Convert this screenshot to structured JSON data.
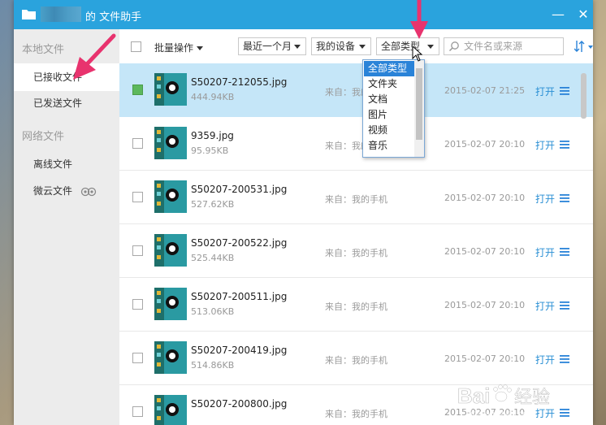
{
  "window": {
    "title": "的 文件助手",
    "minimize_glyph": "—",
    "close_glyph": "✕"
  },
  "sidebar": {
    "local_section": "本地文件",
    "network_section": "网络文件",
    "items": [
      {
        "label": "已接收文件",
        "active": true
      },
      {
        "label": "已发送文件",
        "active": false
      },
      {
        "label": "离线文件",
        "active": false
      },
      {
        "label": "微云文件",
        "active": false
      }
    ]
  },
  "toolbar": {
    "batch_label": "批量操作",
    "time_filter": "最近一个月",
    "device_filter": "我的设备",
    "type_filter": "全部类型",
    "search_placeholder": "文件名或来源"
  },
  "type_dropdown": {
    "options": [
      "全部类型",
      "文件夹",
      "文档",
      "图片",
      "视频",
      "音乐"
    ],
    "highlighted": "全部类型"
  },
  "files": [
    {
      "name": "S50207-212055.jpg",
      "size": "444.94KB",
      "source": "来自：我的手机",
      "date": "2015-02-07 21:25",
      "action": "打开",
      "selected": true
    },
    {
      "name": "9359.jpg",
      "size": "95.95KB",
      "source": "来自：我的手机",
      "date": "2015-02-07 20:10",
      "action": "打开",
      "selected": false
    },
    {
      "name": "S50207-200531.jpg",
      "size": "527.62KB",
      "source": "来自：我的手机",
      "date": "2015-02-07 20:10",
      "action": "打开",
      "selected": false
    },
    {
      "name": "S50207-200522.jpg",
      "size": "525.44KB",
      "source": "来自：我的手机",
      "date": "2015-02-07 20:10",
      "action": "打开",
      "selected": false
    },
    {
      "name": "S50207-200511.jpg",
      "size": "513.06KB",
      "source": "来自：我的手机",
      "date": "2015-02-07 20:10",
      "action": "打开",
      "selected": false
    },
    {
      "name": "S50207-200419.jpg",
      "size": "514.86KB",
      "source": "来自：我的手机",
      "date": "2015-02-07 20:10",
      "action": "打开",
      "selected": false
    },
    {
      "name": "S50207-200800.jpg",
      "size": "",
      "source": "来自：我的手机",
      "date": "2015-02-07 20:10",
      "action": "打开",
      "selected": false
    }
  ],
  "colors": {
    "titlebar": "#2aa3dd",
    "selected_row": "#c5e6f8",
    "link": "#2a8fd4",
    "annotation_arrow": "#e8336e"
  }
}
